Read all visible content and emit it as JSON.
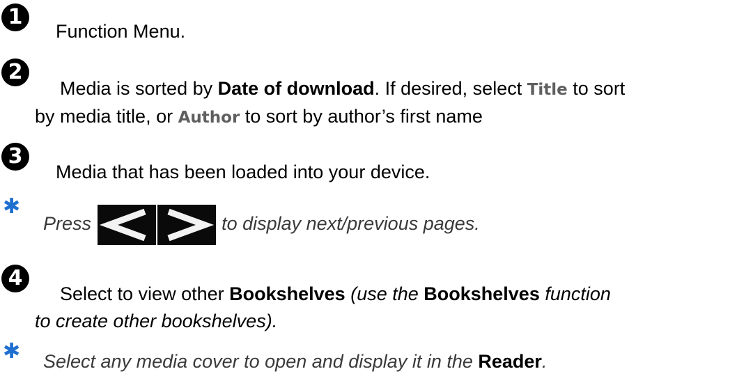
{
  "items": [
    {
      "number": "1",
      "text": "Function Menu."
    },
    {
      "number": "2",
      "line1_a": "Media is sorted by ",
      "line1_b": "Date of download",
      "line1_c": ". If desired, select ",
      "line1_d": "Title",
      "line1_e": " to sort",
      "line2_a": "by media title, or ",
      "line2_b": "Author",
      "line2_c": " to sort by author’s first name"
    },
    {
      "number": "3",
      "text": "Media that has been loaded into your device."
    },
    {
      "star_note_a": "Press",
      "star_note_b": "to display next/previous pages."
    },
    {
      "number": "4",
      "line1_a": "Select to view other ",
      "line1_b": "Bookshelves",
      "line1_c": " (use the ",
      "line1_d": "Bookshelves",
      "line1_e": " function",
      "line2": "to create other bookshelves)."
    },
    {
      "star_note_a": "Select any media cover to open and display it in the ",
      "star_note_b": "Reader",
      "star_note_c": "."
    }
  ],
  "colors": {
    "star": "#1f6fd0",
    "accent": "#5f5f5f"
  },
  "icons": [
    "number-1-icon",
    "number-2-icon",
    "number-3-icon",
    "star-icon",
    "prev-page-arrow-icon",
    "next-page-arrow-icon",
    "number-4-icon",
    "star-icon"
  ]
}
